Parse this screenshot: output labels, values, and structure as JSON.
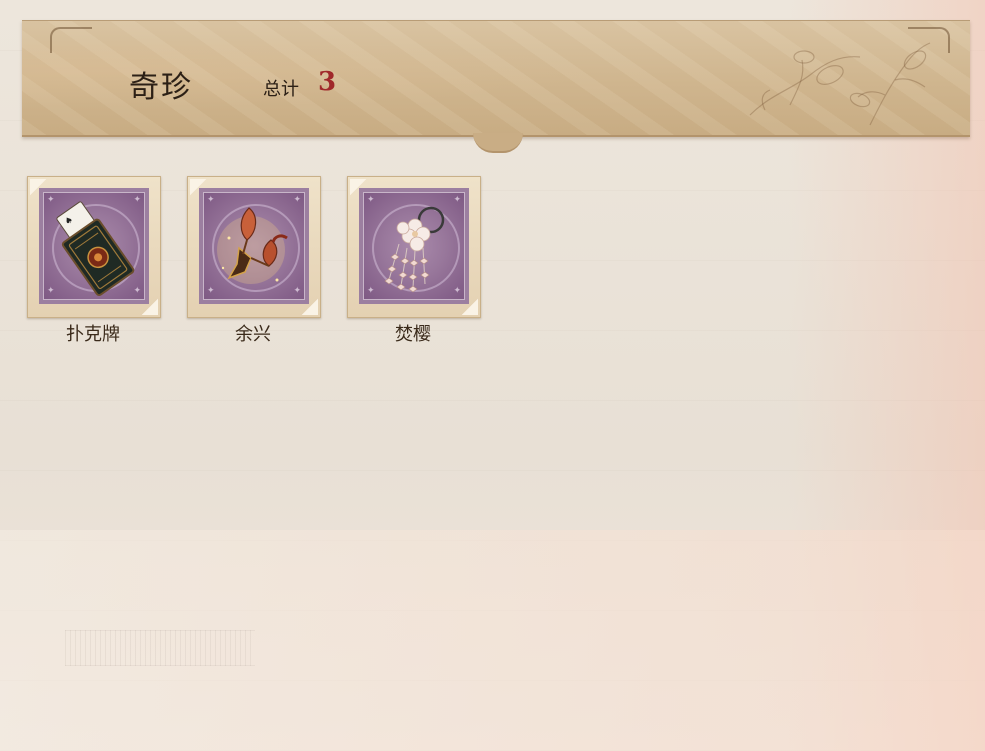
{
  "header": {
    "title": "奇珍",
    "total_label": "总计",
    "total_value": "3"
  },
  "items": [
    {
      "label": "扑克牌",
      "icon": "poker-cards-icon"
    },
    {
      "label": "余兴",
      "icon": "firework-pinwheel-icon"
    },
    {
      "label": "焚樱",
      "icon": "sakura-hairpin-icon"
    }
  ],
  "colors": {
    "header_bg": "#cfb58e",
    "total_value": "#a0282b",
    "stamp_purple": "#98779b",
    "page_bg": "#ece5da"
  }
}
